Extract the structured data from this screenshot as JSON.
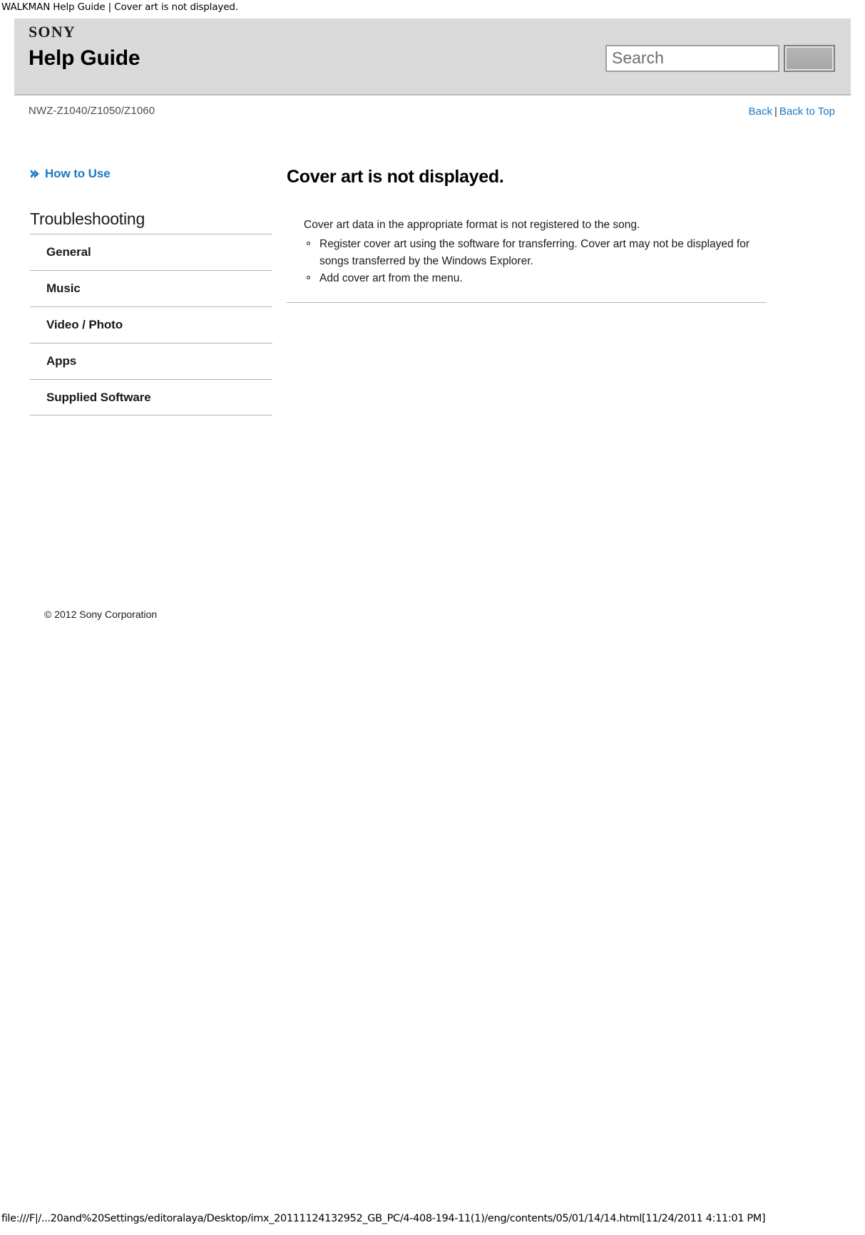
{
  "browser": {
    "print_header": "WALKMAN Help Guide | Cover art is not displayed.",
    "print_footer": "file:///F|/...20and%20Settings/editoralaya/Desktop/imx_20111124132952_GB_PC/4-408-194-11(1)/eng/contents/05/01/14/14.html[11/24/2011 4:11:01 PM]"
  },
  "header": {
    "brand": "SONY",
    "title": "Help Guide",
    "search": {
      "placeholder": "Search",
      "value": "",
      "button_label": ""
    }
  },
  "meta": {
    "model": "NWZ-Z1040/Z1050/Z1060",
    "back_label": "Back",
    "separator": "|",
    "back_to_top_label": "Back to Top"
  },
  "sidebar": {
    "how_to_use": "How to Use",
    "section_title": "Troubleshooting",
    "items": [
      {
        "label": "General"
      },
      {
        "label": "Music"
      },
      {
        "label": "Video / Photo"
      },
      {
        "label": "Apps"
      },
      {
        "label": "Supplied Software"
      }
    ],
    "copyright": "© 2012 Sony Corporation"
  },
  "article": {
    "title": "Cover art is not displayed.",
    "lead": "Cover art data in the appropriate format is not registered to the song.",
    "bullets": [
      "Register cover art using the software for transferring. Cover art may not be displayed for songs transferred by the Windows Explorer.",
      "Add cover art from the menu."
    ]
  },
  "colors": {
    "header_bg": "#dadada",
    "link_blue": "#1879c6",
    "rule_gray": "#b3b3b3",
    "text": "#1a1a1a"
  }
}
